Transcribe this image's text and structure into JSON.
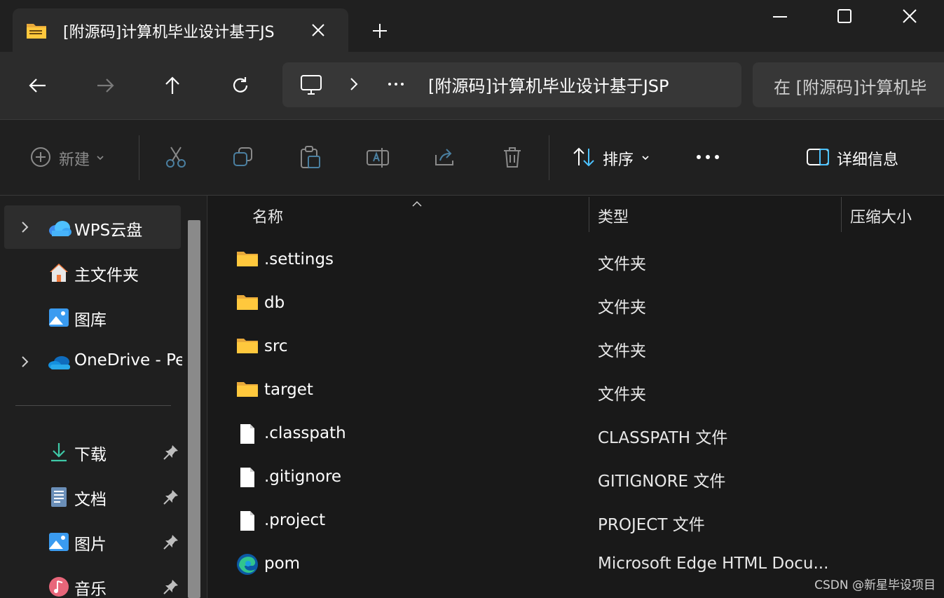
{
  "window": {
    "tab_title": "[附源码]计算机毕业设计基于JS",
    "new_tab_icon": "plus-icon",
    "controls": [
      "minimize-icon",
      "maximize-icon",
      "close-icon"
    ]
  },
  "nav": {
    "address_path": "[附源码]计算机毕业设计基于JSP",
    "search_placeholder": "在 [附源码]计算机毕"
  },
  "toolbar": {
    "new_label": "新建",
    "sort_label": "排序",
    "details_label": "详细信息"
  },
  "sidebar": {
    "items": [
      {
        "label": "WPS云盘",
        "expandable": true,
        "icon": "cloud-icon"
      },
      {
        "label": "主文件夹",
        "expandable": false,
        "icon": "home-icon"
      },
      {
        "label": "图库",
        "expandable": false,
        "icon": "gallery-icon"
      },
      {
        "label": "OneDrive - Pe",
        "expandable": true,
        "icon": "onedrive-icon"
      }
    ],
    "pinned": [
      {
        "label": "下载",
        "icon": "download-icon"
      },
      {
        "label": "文档",
        "icon": "document-icon"
      },
      {
        "label": "图片",
        "icon": "pictures-icon"
      },
      {
        "label": "音乐",
        "icon": "music-icon"
      }
    ]
  },
  "filelist": {
    "columns": [
      "名称",
      "类型",
      "压缩大小"
    ],
    "rows": [
      {
        "name": ".settings",
        "type": "文件夹",
        "icon": "folder-icon"
      },
      {
        "name": "db",
        "type": "文件夹",
        "icon": "folder-icon"
      },
      {
        "name": "src",
        "type": "文件夹",
        "icon": "folder-icon"
      },
      {
        "name": "target",
        "type": "文件夹",
        "icon": "folder-icon"
      },
      {
        "name": ".classpath",
        "type": "CLASSPATH 文件",
        "icon": "file-icon"
      },
      {
        "name": ".gitignore",
        "type": "GITIGNORE 文件",
        "icon": "file-icon"
      },
      {
        "name": ".project",
        "type": "PROJECT 文件",
        "icon": "file-icon"
      },
      {
        "name": "pom",
        "type": "Microsoft Edge HTML Docu...",
        "icon": "edge-icon"
      }
    ]
  },
  "watermark": "CSDN @新星毕设项目",
  "colors": {
    "folder": "#ffc83d",
    "accent": "#4cc2ff",
    "background": "#191919"
  }
}
